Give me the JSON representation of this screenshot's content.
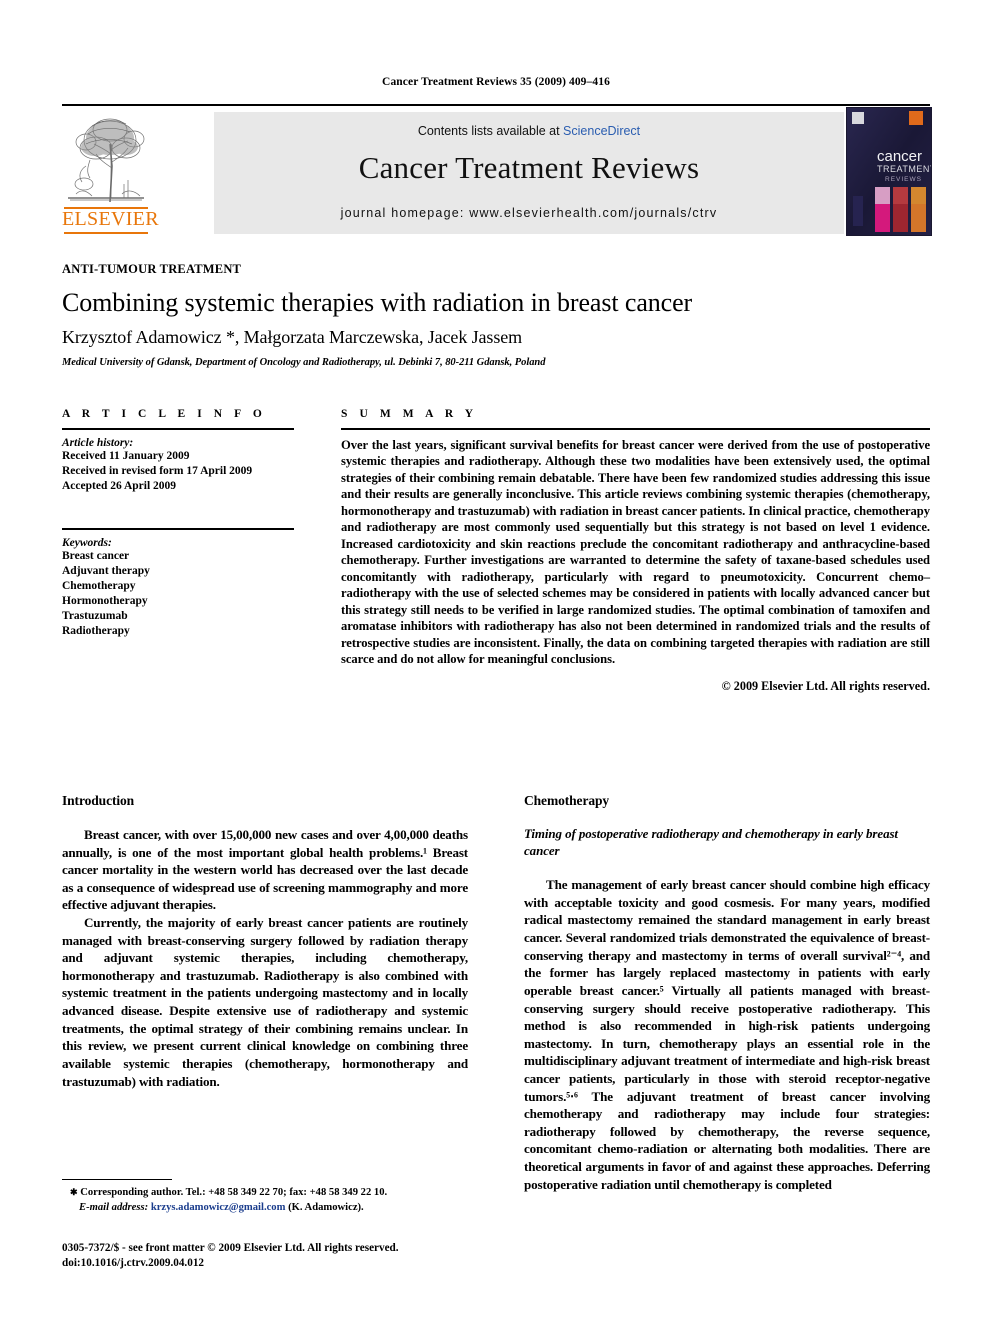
{
  "running_head": "Cancer Treatment Reviews 35 (2009) 409–416",
  "masthead": {
    "contents_prefix": "Contents lists available at ",
    "contents_link": "ScienceDirect",
    "journal_title": "Cancer Treatment Reviews",
    "homepage": "journal homepage: www.elsevierhealth.com/journals/ctrv",
    "publisher_logo_text": "ELSEVIER",
    "cover_title_main": "cancer",
    "cover_title_sub": "TREATMENT",
    "cover_title_sub2": "REVIEWS"
  },
  "article": {
    "kicker": "ANTI-TUMOUR TREATMENT",
    "title": "Combining systemic therapies with radiation in breast cancer",
    "authors": "Krzysztof Adamowicz *, Małgorzata Marczewska, Jacek Jassem",
    "affiliation": "Medical University of Gdansk, Department of Oncology and Radiotherapy, ul. Debinki 7, 80-211 Gdansk, Poland"
  },
  "article_info": {
    "heading": "A R T I C L E   I N F O",
    "history_label": "Article history:",
    "history": [
      "Received 11 January 2009",
      "Received in revised form 17 April 2009",
      "Accepted 26 April 2009"
    ],
    "keywords_label": "Keywords:",
    "keywords": [
      "Breast cancer",
      "Adjuvant therapy",
      "Chemotherapy",
      "Hormonotherapy",
      "Trastuzumab",
      "Radiotherapy"
    ]
  },
  "summary": {
    "heading": "S U M M A R Y",
    "text": "Over the last years, significant survival benefits for breast cancer were derived from the use of postoperative systemic therapies and radiotherapy. Although these two modalities have been extensively used, the optimal strategies of their combining remain debatable. There have been few randomized studies addressing this issue and their results are generally inconclusive. This article reviews combining systemic therapies (chemotherapy, hormonotherapy and trastuzumab) with radiation in breast cancer patients. In clinical practice, chemotherapy and radiotherapy are most commonly used sequentially but this strategy is not based on level 1 evidence. Increased cardiotoxicity and skin reactions preclude the concomitant radiotherapy and anthracycline-based chemotherapy. Further investigations are warranted to determine the safety of taxane-based schedules used concomitantly with radiotherapy, particularly with regard to pneumotoxicity. Concurrent chemo–radiotherapy with the use of selected schemes may be considered in patients with locally advanced cancer but this strategy still needs to be verified in large randomized studies. The optimal combination of tamoxifen and aromatase inhibitors with radiotherapy has also not been determined in randomized trials and the results of retrospective studies are inconsistent. Finally, the data on combining targeted therapies with radiation are still scarce and do not allow for meaningful conclusions.",
    "copyright": "© 2009 Elsevier Ltd. All rights reserved."
  },
  "body": {
    "left": {
      "heading": "Introduction",
      "paragraphs": [
        "Breast cancer, with over 15,00,000 new cases and over 4,00,000 deaths annually, is one of the most important global health problems.¹ Breast cancer mortality in the western world has decreased over the last decade as a consequence of widespread use of screening mammography and more effective adjuvant therapies.",
        "Currently, the majority of early breast cancer patients are routinely managed with breast-conserving surgery followed by radiation therapy and adjuvant systemic therapies, including chemotherapy, hormonotherapy and trastuzumab. Radiotherapy is also combined with systemic treatment in the patients undergoing mastectomy and in locally advanced disease. Despite extensive use of radiotherapy and systemic treatments, the optimal strategy of their combining remains unclear. In this review, we present current clinical knowledge on combining three available systemic therapies (chemotherapy, hormonotherapy and trastuzumab) with radiation."
      ]
    },
    "right": {
      "heading": "Chemotherapy",
      "subheading": "Timing of postoperative radiotherapy and chemotherapy in early breast cancer",
      "paragraphs": [
        "The management of early breast cancer should combine high efficacy with acceptable toxicity and good cosmesis. For many years, modified radical mastectomy remained the standard management in early breast cancer. Several randomized trials demonstrated the equivalence of breast-conserving therapy and mastectomy in terms of overall survival²⁻⁴, and the former has largely replaced mastectomy in patients with early operable breast cancer.⁵ Virtually all patients managed with breast-conserving surgery should receive postoperative radiotherapy. This method is also recommended in high-risk patients undergoing mastectomy. In turn, chemotherapy plays an essential role in the multidisciplinary adjuvant treatment of intermediate and high-risk breast cancer patients, particularly in those with steroid receptor-negative tumors.⁵‧⁶ The adjuvant treatment of breast cancer involving chemotherapy and radiotherapy may include four strategies: radiotherapy followed by chemotherapy, the reverse sequence, concomitant chemo-radiation or alternating both modalities. There are theoretical arguments in favor of and against these approaches. Deferring postoperative radiation until chemotherapy is completed"
      ]
    }
  },
  "footnotes": {
    "corresponding": "Corresponding author. Tel.: +48 58 349 22 70; fax: +48 58 349 22 10.",
    "email_label": "E-mail address:",
    "email": "krzys.adamowicz@gmail.com",
    "email_attrib": "(K. Adamowicz).",
    "issn_line": "0305-7372/$ - see front matter © 2009 Elsevier Ltd. All rights reserved.",
    "doi_line": "doi:10.1016/j.ctrv.2009.04.012"
  }
}
